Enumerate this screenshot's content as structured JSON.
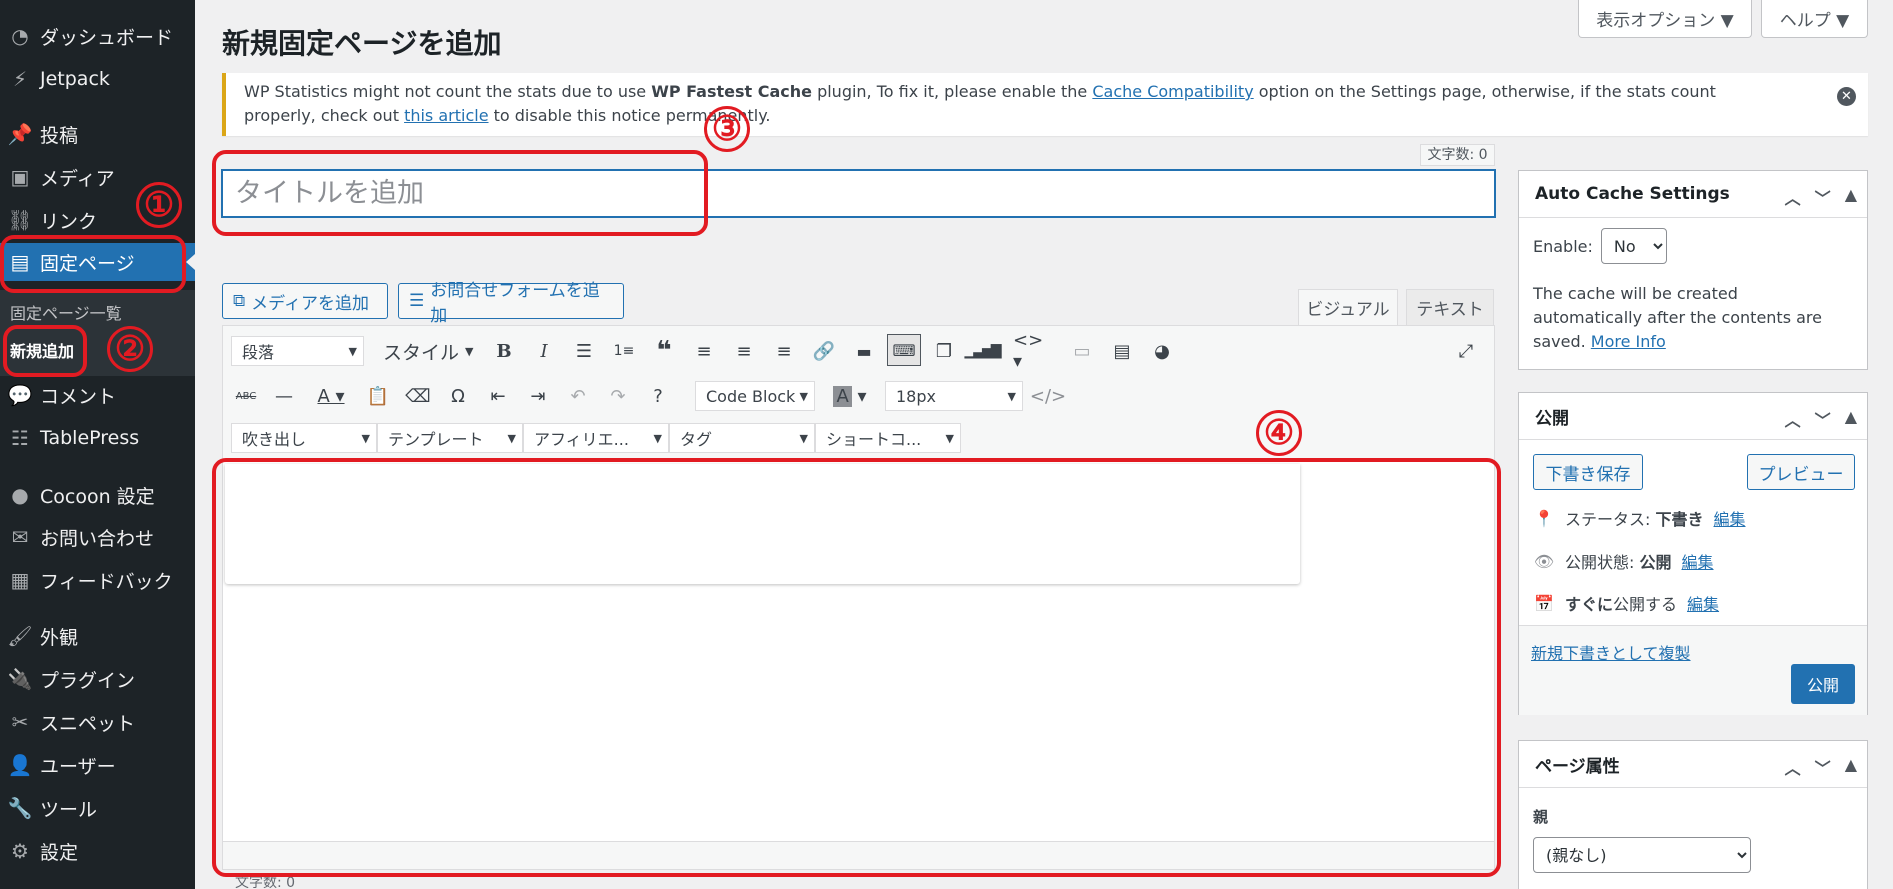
{
  "sidebar": {
    "items": [
      {
        "label": "ダッシュボード",
        "icon": "dashboard-icon"
      },
      {
        "label": "Jetpack",
        "icon": "jetpack-icon"
      },
      {
        "label": "投稿",
        "icon": "pin-icon"
      },
      {
        "label": "メディア",
        "icon": "media-icon"
      },
      {
        "label": "リンク",
        "icon": "link-icon"
      },
      {
        "label": "固定ページ",
        "icon": "pages-icon"
      },
      {
        "label": "コメント",
        "icon": "comment-icon"
      },
      {
        "label": "TablePress",
        "icon": "table-icon"
      },
      {
        "label": "Cocoon 設定",
        "icon": "circle-icon"
      },
      {
        "label": "お問い合わせ",
        "icon": "mail-icon"
      },
      {
        "label": "フィードバック",
        "icon": "feedback-icon"
      },
      {
        "label": "外観",
        "icon": "brush-icon"
      },
      {
        "label": "プラグイン",
        "icon": "plugin-icon"
      },
      {
        "label": "スニペット",
        "icon": "scissors-icon"
      },
      {
        "label": "ユーザー",
        "icon": "user-icon"
      },
      {
        "label": "ツール",
        "icon": "wrench-icon"
      },
      {
        "label": "設定",
        "icon": "settings-icon"
      }
    ],
    "submenu": {
      "all_pages": "固定ページ一覧",
      "add_new": "新規追加"
    }
  },
  "annotations": {
    "n1": "①",
    "n2": "②",
    "n3": "③",
    "n4": "④"
  },
  "header": {
    "title": "新規固定ページを追加",
    "screen_options": "表示オプション ▼",
    "help": "ヘルプ ▼"
  },
  "notice": {
    "text_1": "WP Statistics might not count the stats due to use ",
    "bold": "WP Fastest Cache",
    "text_2": " plugin, To fix it, please enable the ",
    "link_1": "Cache Compatibility",
    "text_3": " option on the Settings page, otherwise, if the stats count properly, check out ",
    "link_2": "this article",
    "text_4": " to disable this notice permanently."
  },
  "title_field": {
    "placeholder": "タイトルを追加",
    "char_count": "文字数: 0"
  },
  "media_buttons": {
    "add_media": "メディアを追加",
    "add_form": "お問合せフォームを追加"
  },
  "editor_tabs": {
    "visual": "ビジュアル",
    "text": "テキスト"
  },
  "toolbar": {
    "paragraph": "段落",
    "style": "スタイル",
    "code_block": "Code Block",
    "font_size": "18px",
    "speech": "吹き出し",
    "template": "テンプレート",
    "affiliate": "アフィリエ...",
    "tag": "タグ",
    "shortcode": "ショートコ..."
  },
  "editor_footer": {
    "char_count": "文字数: 0"
  },
  "auto_cache": {
    "title": "Auto Cache Settings",
    "enable_label": "Enable:",
    "enable_value": "No",
    "description": "The cache will be created automatically after the contents are saved.",
    "more_info": "More Info"
  },
  "publish": {
    "title": "公開",
    "save_draft": "下書き保存",
    "preview": "プレビュー",
    "status_label": "ステータス: ",
    "status_value": "下書き",
    "visibility_label": "公開状態: ",
    "visibility_value": "公開",
    "schedule_bold": "すぐに",
    "schedule_rest": "公開する",
    "edit": "編集",
    "copy_draft": "新規下書きとして複製",
    "publish_button": "公開"
  },
  "page_attributes": {
    "title": "ページ属性",
    "parent_label": "親",
    "parent_value": "(親なし)"
  }
}
